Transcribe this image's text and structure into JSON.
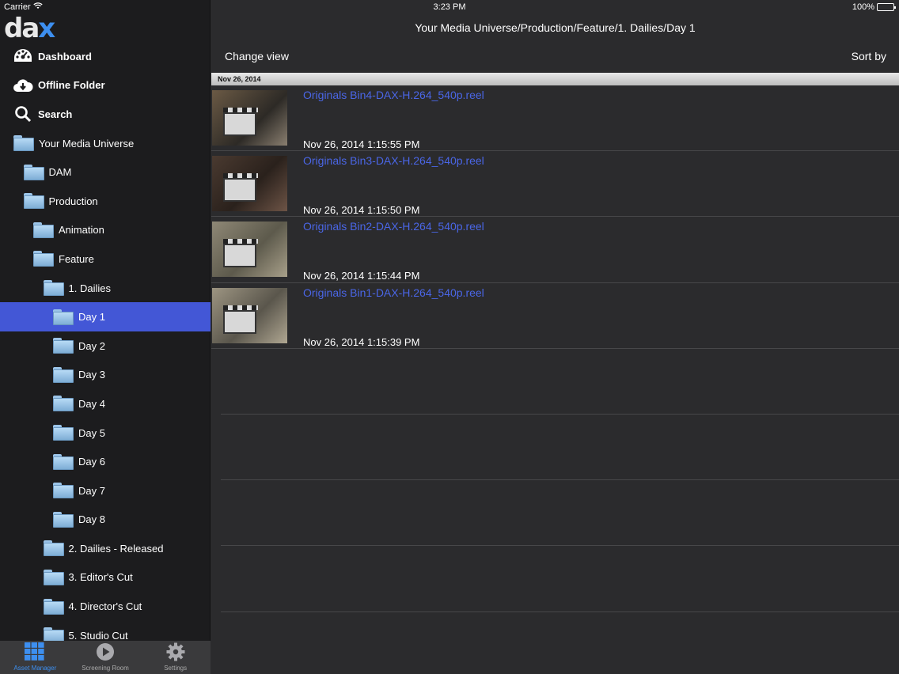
{
  "status": {
    "carrier": "Carrier",
    "time": "3:23 PM",
    "battery": "100%"
  },
  "logo": {
    "part1": "da",
    "part2": "x"
  },
  "sidebar": {
    "items": [
      {
        "label": "Dashboard",
        "icon": "dashboard-icon",
        "bold": true,
        "indent": 0
      },
      {
        "label": "Offline Folder",
        "icon": "cloud-download-icon",
        "bold": true,
        "indent": 0
      },
      {
        "label": "Search",
        "icon": "search-icon",
        "bold": true,
        "indent": 0
      },
      {
        "label": "Your Media Universe",
        "icon": "folder-icon",
        "bold": false,
        "indent": 0
      },
      {
        "label": "DAM",
        "icon": "folder-icon",
        "bold": false,
        "indent": 1
      },
      {
        "label": "Production",
        "icon": "folder-icon",
        "bold": false,
        "indent": 1
      },
      {
        "label": "Animation",
        "icon": "folder-icon",
        "bold": false,
        "indent": 2
      },
      {
        "label": "Feature",
        "icon": "folder-icon",
        "bold": false,
        "indent": 2
      },
      {
        "label": "1. Dailies",
        "icon": "folder-icon",
        "bold": false,
        "indent": 3
      },
      {
        "label": "Day 1",
        "icon": "folder-icon",
        "bold": false,
        "indent": 4,
        "selected": true
      },
      {
        "label": "Day 2",
        "icon": "folder-icon",
        "bold": false,
        "indent": 4
      },
      {
        "label": "Day 3",
        "icon": "folder-icon",
        "bold": false,
        "indent": 4
      },
      {
        "label": "Day 4",
        "icon": "folder-icon",
        "bold": false,
        "indent": 4
      },
      {
        "label": "Day 5",
        "icon": "folder-icon",
        "bold": false,
        "indent": 4
      },
      {
        "label": "Day 6",
        "icon": "folder-icon",
        "bold": false,
        "indent": 4
      },
      {
        "label": "Day 7",
        "icon": "folder-icon",
        "bold": false,
        "indent": 4
      },
      {
        "label": "Day 8",
        "icon": "folder-icon",
        "bold": false,
        "indent": 4
      },
      {
        "label": "2. Dailies - Released",
        "icon": "folder-icon",
        "bold": false,
        "indent": 3
      },
      {
        "label": "3. Editor's Cut",
        "icon": "folder-icon",
        "bold": false,
        "indent": 3
      },
      {
        "label": "4. Director's Cut",
        "icon": "folder-icon",
        "bold": false,
        "indent": 3
      },
      {
        "label": "5. Studio Cut",
        "icon": "folder-icon",
        "bold": false,
        "indent": 3
      }
    ]
  },
  "tabbar": [
    {
      "label": "Asset Manager",
      "icon": "grid-icon",
      "active": true
    },
    {
      "label": "Screening Room",
      "icon": "play-icon",
      "active": false
    },
    {
      "label": "Settings",
      "icon": "gear-icon",
      "active": false
    }
  ],
  "main": {
    "path": "Your Media Universe/Production/Feature/1. Dailies/Day 1",
    "change_view": "Change view",
    "sort_by": "Sort by",
    "date_header": "Nov 26, 2014",
    "assets": [
      {
        "name": "Originals Bin4-DAX-H.264_540p.reel",
        "date": "Nov 26, 2014 1:15:55 PM"
      },
      {
        "name": "Originals Bin3-DAX-H.264_540p.reel",
        "date": "Nov 26, 2014 1:15:50 PM"
      },
      {
        "name": "Originals Bin2-DAX-H.264_540p.reel",
        "date": "Nov 26, 2014 1:15:44 PM"
      },
      {
        "name": "Originals Bin1-DAX-H.264_540p.reel",
        "date": "Nov 26, 2014 1:15:39 PM"
      }
    ]
  },
  "colors": {
    "accent": "#3d8ff0",
    "selected_row": "#4357d6",
    "link": "#4a66e6"
  }
}
